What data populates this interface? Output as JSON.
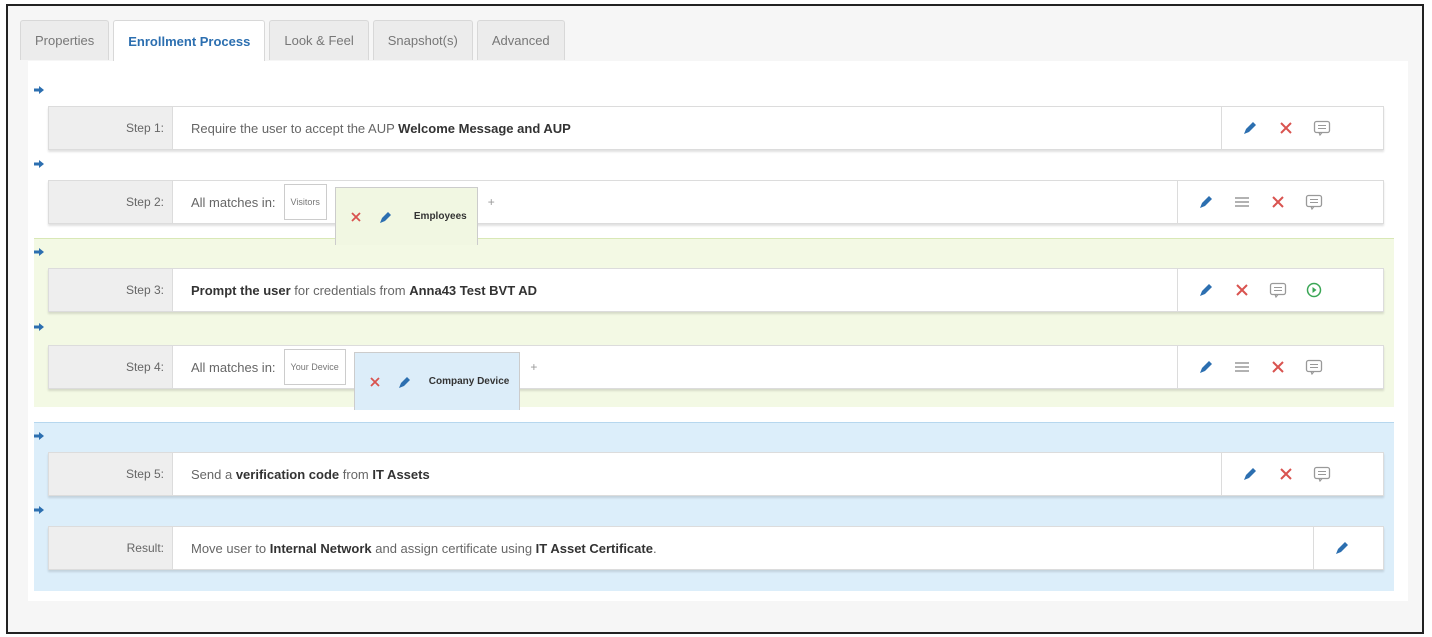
{
  "tabs": [
    "Properties",
    "Enrollment Process",
    "Look & Feel",
    "Snapshot(s)",
    "Advanced"
  ],
  "active_tab": "Enrollment Process",
  "steps": [
    {
      "label": "Step 1:",
      "pre": "Require the user to accept the AUP ",
      "bold": "Welcome Message and AUP"
    },
    {
      "label": "Step 2:",
      "prefix": "All matches in:",
      "chip": "Visitors",
      "selected": "Employees",
      "plus": "+"
    },
    {
      "label": "Step 3:",
      "bold1": "Prompt the user",
      "mid": " for credentials from ",
      "bold2": "Anna43 Test BVT AD"
    },
    {
      "label": "Step 4:",
      "prefix": "All matches in:",
      "chip": "Your Device",
      "selected": "Company Device",
      "plus": "+"
    },
    {
      "label": "Step 5:",
      "pre": "Send a ",
      "bold1": "verification code",
      "mid": " from ",
      "bold2": "IT Assets"
    },
    {
      "label": "Result:",
      "pre": "Move user to ",
      "bold1": "Internal Network",
      "mid": " and assign certificate using ",
      "bold2": "IT Asset Certificate",
      "post": "."
    }
  ],
  "icons": {
    "edit": "pencil-icon",
    "delete": "x-icon",
    "comment": "comment-icon",
    "list": "list-icon",
    "play": "play-circle-icon",
    "arrow": "arrow-right-icon"
  },
  "colors": {
    "accent_blue": "#2c6fb0",
    "delete_red": "#d9534f",
    "band_green": "#f3f9e4",
    "band_blue": "#dceefa",
    "play_green": "#3aa655"
  }
}
